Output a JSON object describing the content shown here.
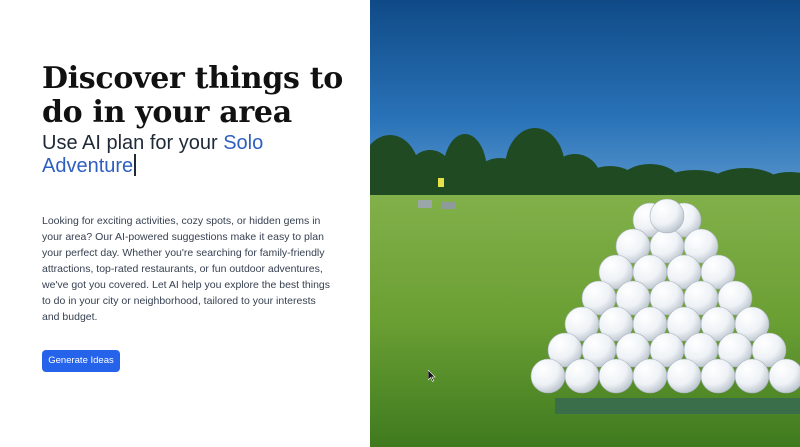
{
  "hero": {
    "title": "Discover things to do in your area",
    "subtitle_prefix": "Use AI plan for your ",
    "subtitle_accent": "Solo Adventure",
    "description": "Looking for exciting activities, cozy spots, or hidden gems in your area? Our AI-powered suggestions make it easy to plan your perfect day. Whether you're searching for family-friendly attractions, top-rated restaurants, or fun outdoor adventures, we've got you covered. Let AI help you explore the best things to do in your city or neighborhood, tailored to your interests and budget.",
    "button_label": "Generate Ideas"
  },
  "image": {
    "subject": "pyramid of golf balls on driving range grass"
  },
  "colors": {
    "accent": "#2f5fbf",
    "button": "#2563eb",
    "sky": "#1e5b9c",
    "grass": "#6fa33a"
  }
}
